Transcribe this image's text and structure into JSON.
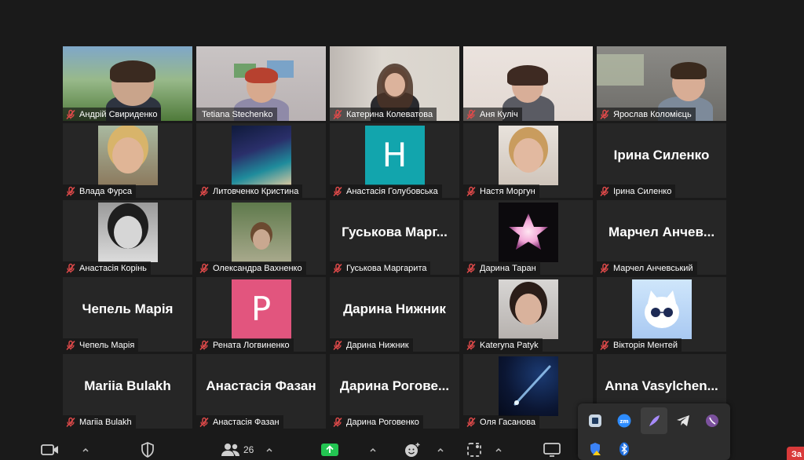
{
  "participants": [
    {
      "name": "Андрій Свириденко",
      "tile": "video"
    },
    {
      "name": "Tetiana Stechenko",
      "tile": "video",
      "active": true
    },
    {
      "name": "Катерина Колеватова",
      "tile": "video"
    },
    {
      "name": "Аня Куліч",
      "tile": "video"
    },
    {
      "name": "Ярослав Коломієць",
      "tile": "video"
    },
    {
      "name": "Влада Фурса",
      "tile": "photo"
    },
    {
      "name": "Литовченко Кристина",
      "tile": "photo"
    },
    {
      "name": "Анастасія Голубовська",
      "tile": "letter",
      "letter": "H",
      "color": "#12a5ad"
    },
    {
      "name": "Настя Моргун",
      "tile": "photo"
    },
    {
      "name": "Ірина Силенко",
      "tile": "text",
      "display": "Ірина Силенко"
    },
    {
      "name": "Анастасія Корінь",
      "tile": "photo"
    },
    {
      "name": "Олександра Вахненко",
      "tile": "photo"
    },
    {
      "name": "Гуськова Маргарита",
      "tile": "text",
      "display": "Гуськова Марг..."
    },
    {
      "name": "Дарина Таран",
      "tile": "photo"
    },
    {
      "name": "Марчел Анчевський",
      "tile": "text",
      "display": "Марчел Анчев..."
    },
    {
      "name": "Чепель Марія",
      "tile": "text",
      "display": "Чепель Марія"
    },
    {
      "name": "Рената Логвиненко",
      "tile": "letter",
      "letter": "P",
      "color": "#e2557e"
    },
    {
      "name": "Дарина Нижник",
      "tile": "text",
      "display": "Дарина Нижник"
    },
    {
      "name": "Kateryna Patyk",
      "tile": "photo"
    },
    {
      "name": "Вікторія Ментей",
      "tile": "photo"
    },
    {
      "name": "Mariia Bulakh",
      "tile": "text",
      "display": "Mariia Bulakh"
    },
    {
      "name": "Анастасія Фазан",
      "tile": "text",
      "display": "Анастасія Фазан"
    },
    {
      "name": "Дарина Роговенко",
      "tile": "text",
      "display": "Дарина Рогове..."
    },
    {
      "name": "Оля Гасанова",
      "tile": "photo"
    },
    {
      "name": "Anna Vasylchenko",
      "tile": "text",
      "display": "Anna Vasylchen..."
    }
  ],
  "toolbar": {
    "participants_count": "26",
    "end_label": "За"
  },
  "colors": {
    "active_speaker": "#d7e86a",
    "share_green": "#23c552",
    "end_red": "#d93a3a"
  }
}
